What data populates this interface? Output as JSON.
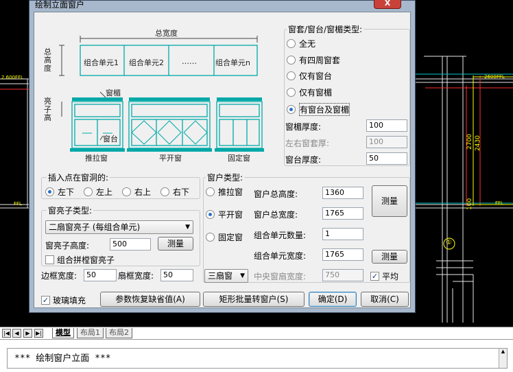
{
  "cad": {
    "left_text": "2.600FFL",
    "right_text": "2600FFL",
    "fl_left": "FFL",
    "fl_right": "FFL",
    "dim_2700": "2700",
    "dim_2430": "2430",
    "dim_100": "100",
    "axis_label": "①"
  },
  "dialog": {
    "title": "绘制立面窗户",
    "close_label": "X",
    "diagram": {
      "total_width": "总宽度",
      "total_height": "总高度",
      "cells": [
        "组合单元1",
        "组合单元2",
        "……",
        "组合单元n"
      ],
      "transom_label": "窗楣",
      "transom_height": "亮子高",
      "sill_label": "窗台",
      "captions": [
        "推拉窗",
        "平开窗",
        "固定窗"
      ]
    },
    "trim_group": {
      "label": "窗套/窗台/窗楣类型:",
      "options": [
        "全无",
        "有四周窗套",
        "仅有窗台",
        "仅有窗楣",
        "有窗台及窗楣"
      ],
      "selected_index": 4,
      "fields": [
        {
          "label": "窗楣厚度:",
          "value": "100",
          "disabled": false
        },
        {
          "label": "左右窗套厚:",
          "value": "100",
          "disabled": true
        },
        {
          "label": "窗台厚度:",
          "value": "50",
          "disabled": false
        }
      ]
    },
    "insert_group": {
      "label": "插入点在窗洞的:",
      "options": [
        "左下",
        "左上",
        "右上",
        "右下"
      ],
      "selected_index": 0
    },
    "transom_group": {
      "label": "窗亮子类型:",
      "select_value": "二扇窗亮子 (每组合单元)",
      "height_label": "窗亮子高度:",
      "height_value": "500",
      "measure_label": "测量",
      "combine_label": "组合拼樘窗亮子",
      "combine_checked": false
    },
    "frame": {
      "border_label": "边框宽度:",
      "border_value": "50",
      "sash_label": "扇框宽度:",
      "sash_value": "50"
    },
    "window_group": {
      "label": "窗户类型:",
      "types": [
        "推拉窗",
        "平开窗",
        "固定窗"
      ],
      "selected_index": 1,
      "total_height_label": "窗户总高度:",
      "total_height_value": "1360",
      "total_width_label": "窗户总宽度:",
      "total_width_value": "1765",
      "measure_label": "测量",
      "unit_count_label": "组合单元数量:",
      "unit_count_value": "1",
      "unit_width_label": "组合单元宽度:",
      "unit_width_value": "1765",
      "unit_measure_label": "测量",
      "sash_select": "三扇窗",
      "center_label": "中央窗扇宽度:",
      "center_value": "750",
      "average_label": "平均",
      "average_checked": true
    },
    "glass_label": "玻璃填充",
    "glass_checked": true,
    "buttons": {
      "restore": "参数恢复缺省值(A)",
      "batch": "矩形批量转窗户(S)",
      "ok": "确定(D)",
      "cancel": "取消(C)"
    }
  },
  "tabs": [
    "模型",
    "布局1",
    "布局2"
  ],
  "nav_buttons": [
    "|◀",
    "◀",
    "▶",
    "▶|"
  ],
  "command": "***  绘制窗户立面  ***"
}
